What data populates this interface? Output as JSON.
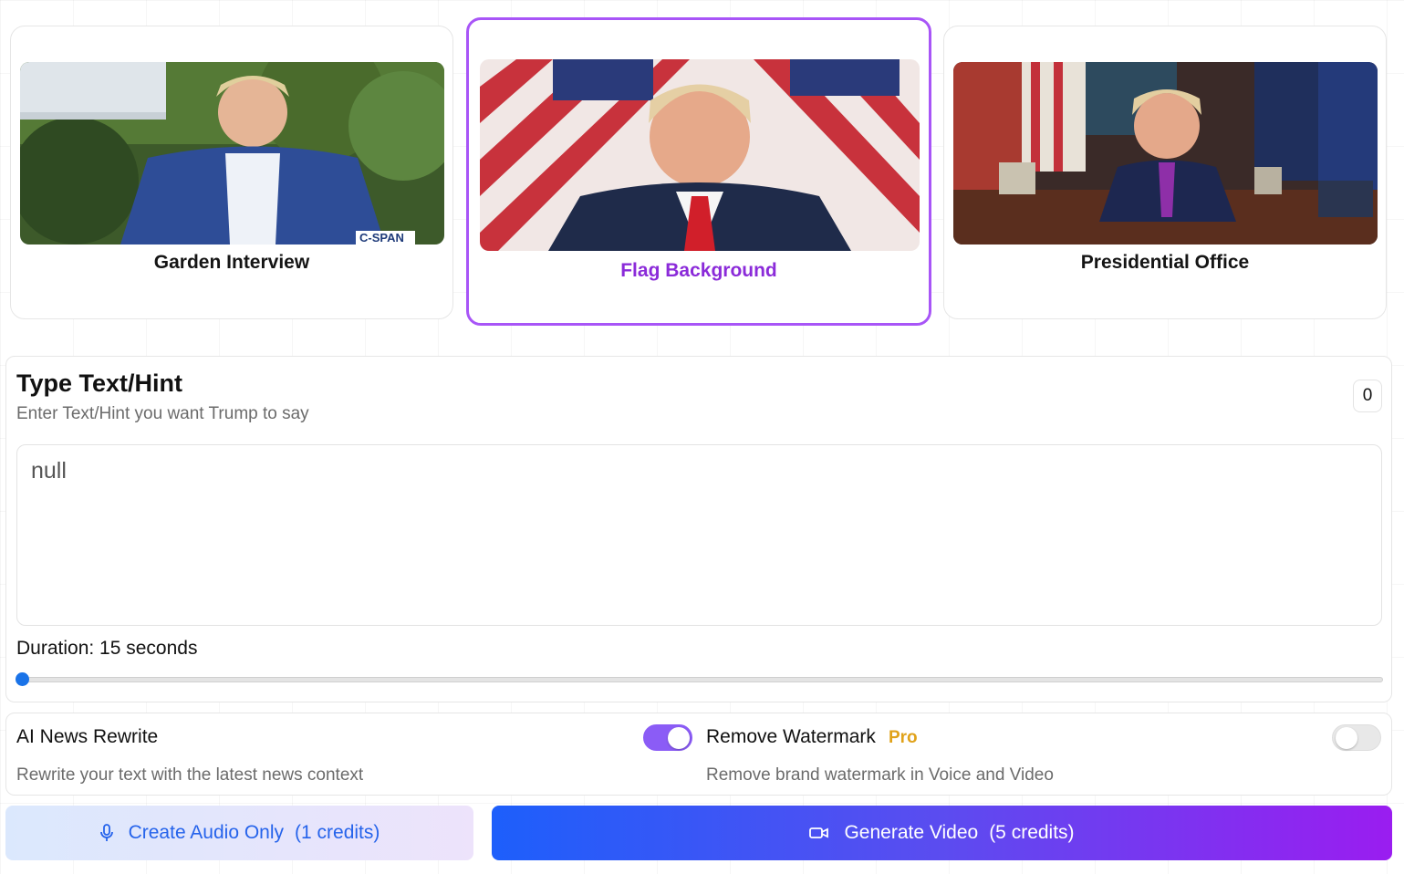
{
  "scenes": [
    {
      "label": "Garden Interview",
      "selected": false
    },
    {
      "label": "Flag Background",
      "selected": true
    },
    {
      "label": "Presidential Office",
      "selected": false
    }
  ],
  "text_panel": {
    "title": "Type Text/Hint",
    "subtitle": "Enter Text/Hint you want Trump to say",
    "char_count": "0",
    "textarea_value": "null",
    "duration_label": "Duration: 15 seconds"
  },
  "options": {
    "ai_rewrite": {
      "label": "AI News Rewrite",
      "description": "Rewrite your text with the latest news context",
      "enabled": true
    },
    "watermark": {
      "label": "Remove Watermark",
      "badge": "Pro",
      "description": "Remove brand watermark in Voice and Video",
      "enabled": false
    }
  },
  "buttons": {
    "audio": {
      "label": "Create Audio Only",
      "credits": "(1 credits)",
      "icon": "microphone-icon"
    },
    "video": {
      "label": "Generate Video",
      "credits": "(5 credits)",
      "icon": "video-camera-icon"
    }
  },
  "colors": {
    "accent_purple": "#a855f7",
    "selected_label": "#8b2bd9",
    "toggle_on": "#8b5cf6",
    "pro_badge": "#e0a21a",
    "audio_text": "#2563eb"
  },
  "thumbnail_text": {
    "garden_broadcaster": "C-SPAN"
  }
}
